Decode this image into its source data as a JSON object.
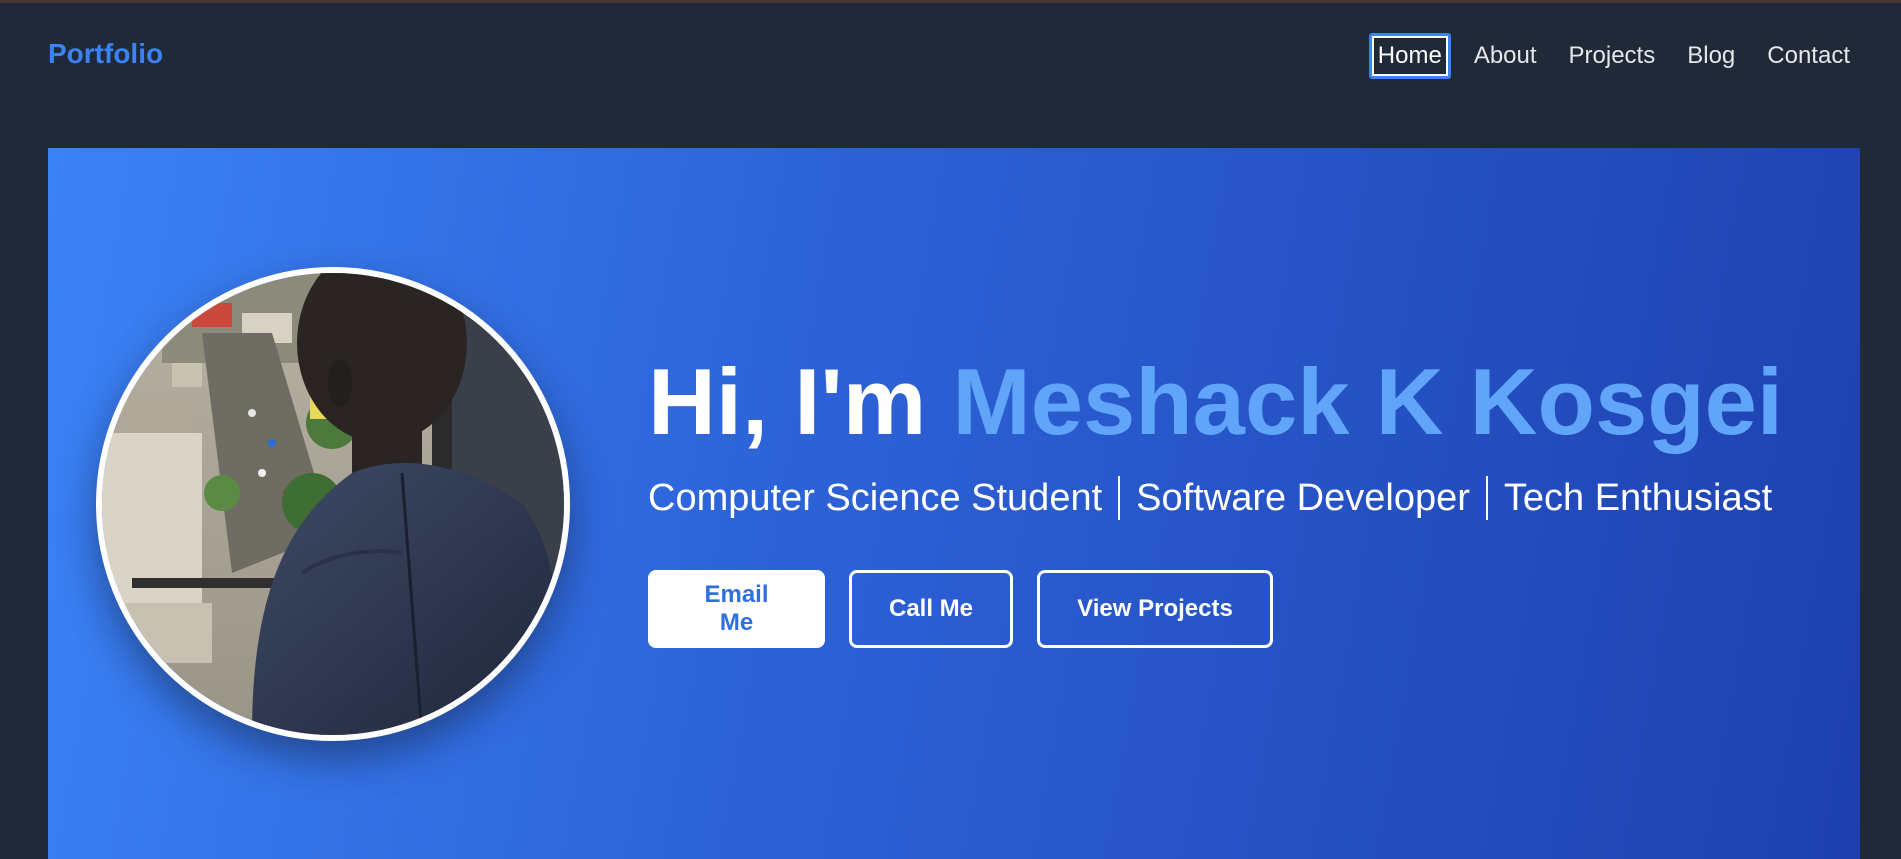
{
  "nav": {
    "brand": "Portfolio",
    "links": [
      {
        "label": "Home",
        "active": true
      },
      {
        "label": "About",
        "active": false
      },
      {
        "label": "Projects",
        "active": false
      },
      {
        "label": "Blog",
        "active": false
      },
      {
        "label": "Contact",
        "active": false
      }
    ]
  },
  "hero": {
    "greeting": "Hi, I'm ",
    "name": "Meshack K Kosgei",
    "roles": [
      "Computer Science Student",
      "Software Developer",
      "Tech Enthusiast"
    ],
    "buttons": {
      "email": "Email Me",
      "call": "Call Me",
      "projects": "View Projects"
    }
  },
  "colors": {
    "background": "#1f2937",
    "accent": "#3b82f6",
    "name_highlight": "#60a5fa",
    "hero_gradient_start": "#3b82f6",
    "hero_gradient_end": "#1e40af"
  }
}
